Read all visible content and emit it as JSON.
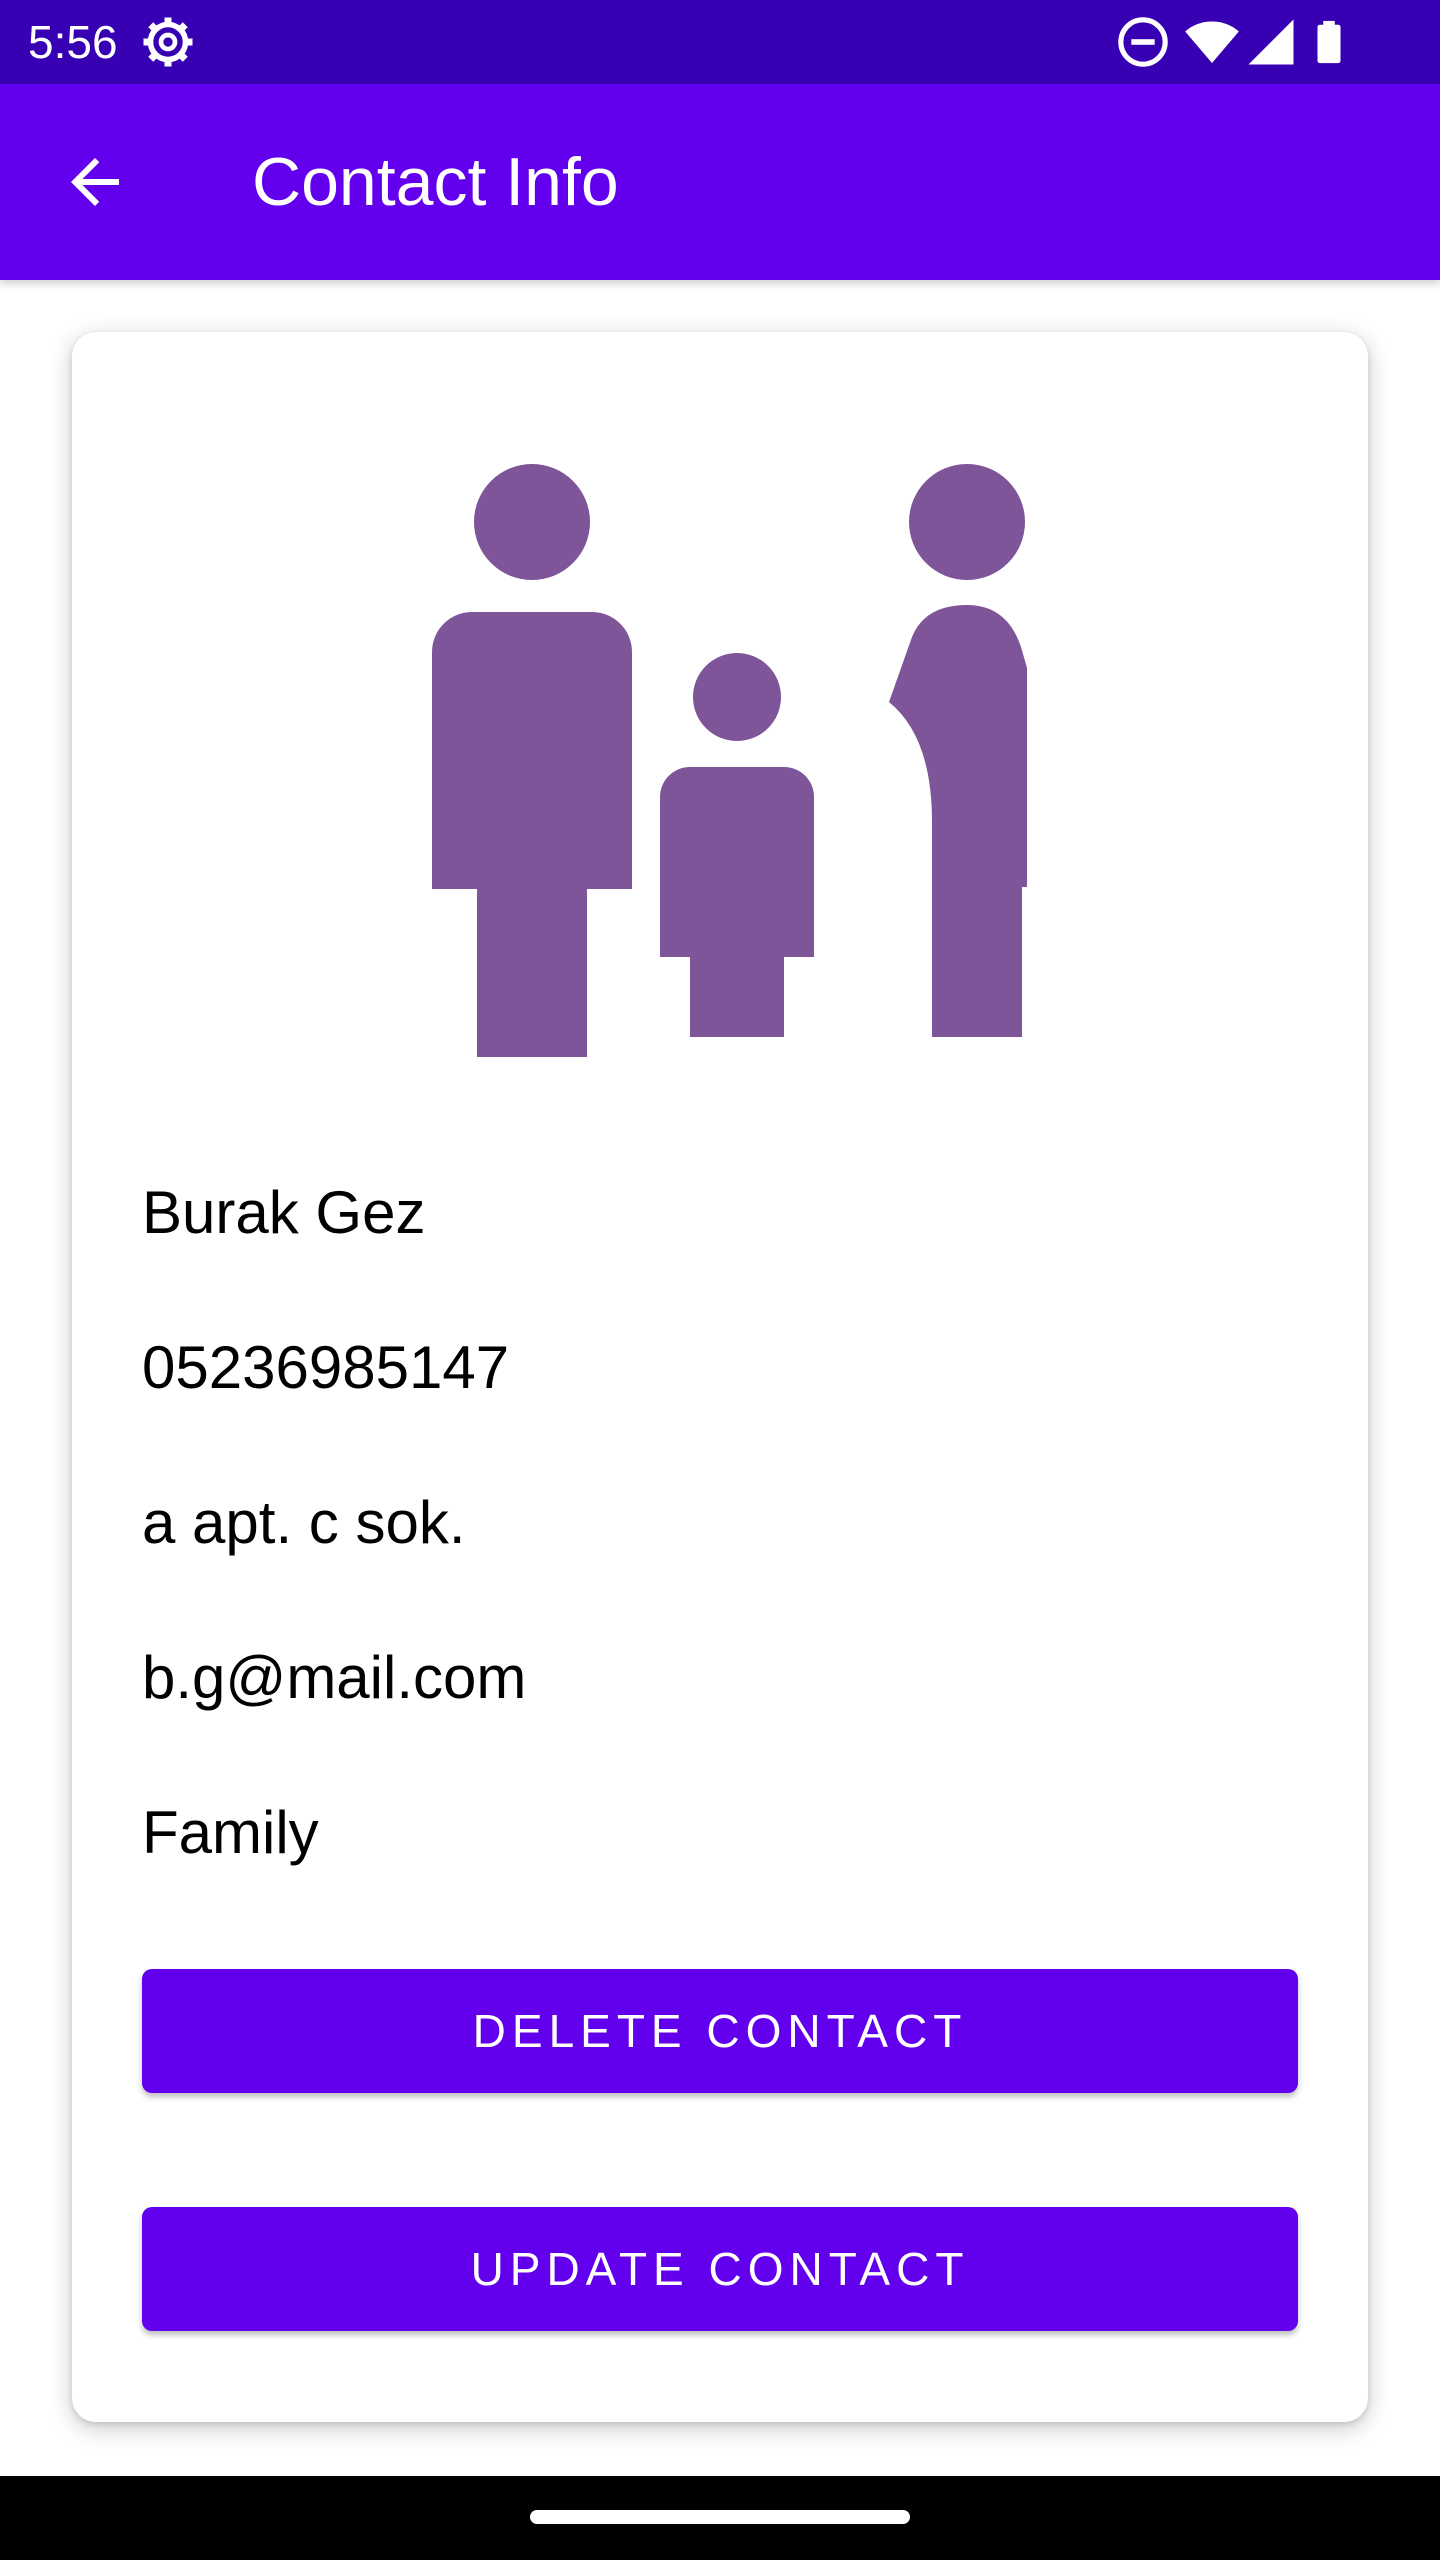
{
  "status_bar": {
    "time": "5:56",
    "left_icons": [
      "settings-gear-icon"
    ],
    "right_icons": [
      "do-not-disturb-icon",
      "wifi-icon",
      "signal-icon",
      "battery-icon"
    ],
    "background_color": "#3700B3"
  },
  "app_bar": {
    "title": "Contact Info",
    "back_icon": "arrow-back-icon",
    "background_color": "#6200EE"
  },
  "contact": {
    "icon": "family-icon",
    "icon_color": "#7E5598",
    "name": "Burak Gez",
    "phone": "05236985147",
    "address": "a apt. c sok.",
    "email": "b.g@mail.com",
    "group": "Family"
  },
  "actions": {
    "delete_label": "DELETE CONTACT",
    "update_label": "UPDATE CONTACT",
    "button_color": "#6200EE"
  }
}
